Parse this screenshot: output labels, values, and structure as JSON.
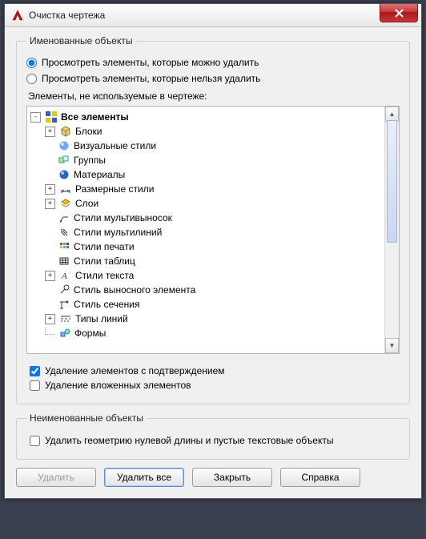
{
  "window": {
    "title": "Очистка чертежа"
  },
  "named_group": {
    "legend": "Именованные объекты",
    "radio_can_delete": "Просмотреть элементы, которые можно удалить",
    "radio_cannot_delete": "Просмотреть элементы, которые нельзя удалить",
    "tree_label": "Элементы, не используемые в чертеже:",
    "root": "Все элементы",
    "items": {
      "blocks": "Блоки",
      "visual_styles": "Визуальные стили",
      "groups": "Группы",
      "materials": "Материалы",
      "dim_styles": "Размерные стили",
      "layers": "Слои",
      "mleader_styles": "Стили мультивыносок",
      "mline_styles": "Стили мультилиний",
      "plot_styles": "Стили печати",
      "table_styles": "Стили таблиц",
      "text_styles": "Стили текста",
      "leader_style": "Стиль выносного элемента",
      "section_style": "Стиль сечения",
      "line_types": "Типы линий",
      "shapes": "Формы"
    },
    "chk_confirm": "Удаление элементов с подтверждением",
    "chk_nested": "Удаление вложенных элементов"
  },
  "unnamed_group": {
    "legend": "Неименованные объекты",
    "chk_zero": "Удалить геометрию нулевой длины и пустые текстовые объекты"
  },
  "buttons": {
    "delete": "Удалить",
    "delete_all": "Удалить все",
    "close": "Закрыть",
    "help": "Справка"
  }
}
